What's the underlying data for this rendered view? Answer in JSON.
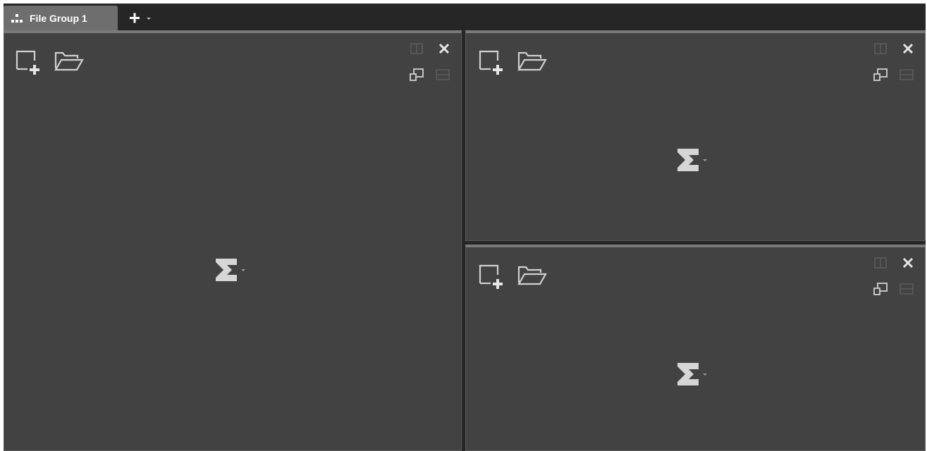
{
  "tabs": [
    {
      "label": "File Group 1",
      "icon": "group-icon",
      "active": true
    }
  ],
  "add_tab": {
    "icon": "plus-icon",
    "dropdown_icon": "caret-down-icon"
  },
  "colors": {
    "background": "#262626",
    "pane": "#424242",
    "tab_active": "#6e6e6e",
    "icon": "#d0d0d0",
    "icon_dim": "#5c5c5c"
  },
  "panes": [
    {
      "id": "left",
      "toolbar": [
        "new-file-icon",
        "open-folder-icon"
      ],
      "controls": [
        "split-vertical-icon",
        "close-icon",
        "float-icon",
        "split-horizontal-icon"
      ],
      "center": {
        "icon": "sigma-icon",
        "dropdown_icon": "caret-down-icon"
      }
    },
    {
      "id": "top-right",
      "toolbar": [
        "new-file-icon",
        "open-folder-icon"
      ],
      "controls": [
        "split-vertical-icon",
        "close-icon",
        "float-icon",
        "split-horizontal-icon"
      ],
      "center": {
        "icon": "sigma-icon",
        "dropdown_icon": "caret-down-icon"
      }
    },
    {
      "id": "bottom-right",
      "toolbar": [
        "new-file-icon",
        "open-folder-icon"
      ],
      "controls": [
        "split-vertical-icon",
        "close-icon",
        "float-icon",
        "split-horizontal-icon"
      ],
      "center": {
        "icon": "sigma-icon",
        "dropdown_icon": "caret-down-icon"
      }
    }
  ]
}
